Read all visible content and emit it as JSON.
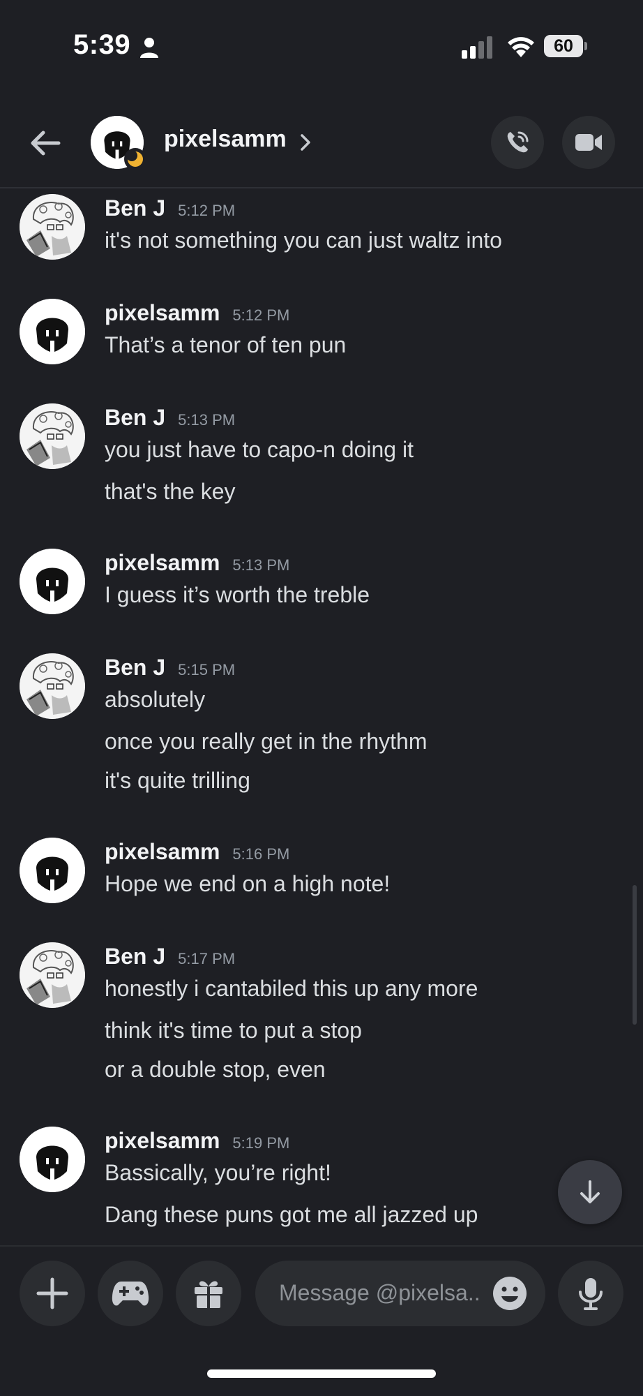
{
  "status_bar": {
    "time": "5:39",
    "battery": "60"
  },
  "header": {
    "title": "pixelsamm"
  },
  "composer": {
    "placeholder": "Message @pixelsa.."
  },
  "messages": [
    {
      "author": "Ben J",
      "time": "5:12 PM",
      "lines": [
        "it's not something you can just waltz into"
      ]
    },
    {
      "author": "pixelsamm",
      "time": "5:12 PM",
      "lines": [
        "That’s a tenor of ten pun"
      ]
    },
    {
      "author": "Ben J",
      "time": "5:13 PM",
      "lines": [
        "you just have to capo-n doing it",
        "that's the key"
      ]
    },
    {
      "author": "pixelsamm",
      "time": "5:13 PM",
      "lines": [
        "I guess it’s worth the treble"
      ]
    },
    {
      "author": "Ben J",
      "time": "5:15 PM",
      "lines": [
        "absolutely",
        "once you really get in the rhythm",
        "it's quite trilling"
      ]
    },
    {
      "author": "pixelsamm",
      "time": "5:16 PM",
      "lines": [
        "Hope we end on a high note!"
      ]
    },
    {
      "author": "Ben J",
      "time": "5:17 PM",
      "lines": [
        "honestly i cantabiled this up any more",
        "think it's time to put a stop",
        "or a double stop, even"
      ]
    },
    {
      "author": "pixelsamm",
      "time": "5:19 PM",
      "lines": [
        "Bassically, you’re right!",
        "Dang these puns got me all jazzed up"
      ]
    }
  ]
}
